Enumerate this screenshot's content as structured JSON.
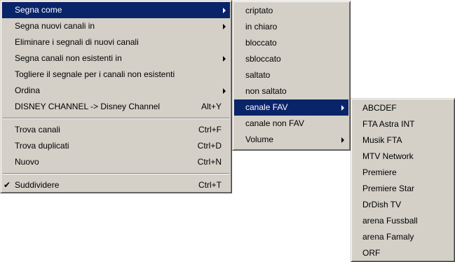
{
  "main_menu": {
    "items": [
      {
        "label": "Segna come",
        "shortcut": "",
        "submenu": true,
        "highlighted": true
      },
      {
        "label": "Segna nuovi canali in",
        "shortcut": "",
        "submenu": true
      },
      {
        "label": "Eliminare i segnali di nuovi canali",
        "shortcut": "",
        "submenu": false
      },
      {
        "label": "Segna canali non esistenti in",
        "shortcut": "",
        "submenu": true
      },
      {
        "label": "Togliere il segnale per i canali non esistenti",
        "shortcut": "",
        "submenu": false
      },
      {
        "label": "Ordina",
        "shortcut": "",
        "submenu": true
      },
      {
        "label": "DISNEY CHANNEL -> Disney Channel",
        "shortcut": "Alt+Y",
        "submenu": false
      }
    ],
    "items2": [
      {
        "label": "Trova canali",
        "shortcut": "Ctrl+F"
      },
      {
        "label": "Trova duplicati",
        "shortcut": "Ctrl+D"
      },
      {
        "label": "Nuovo",
        "shortcut": "Ctrl+N"
      }
    ],
    "items3": [
      {
        "label": "Suddividere",
        "shortcut": "Ctrl+T",
        "checked": true,
        "check_glyph": "✔"
      }
    ]
  },
  "segna_come_menu": {
    "items": [
      {
        "label": "criptato"
      },
      {
        "label": "in chiaro"
      },
      {
        "label": "bloccato"
      },
      {
        "label": "sbloccato"
      },
      {
        "label": "saltato"
      },
      {
        "label": "non saltato"
      },
      {
        "label": "canale FAV",
        "submenu": true,
        "highlighted": true
      },
      {
        "label": "canale non FAV"
      },
      {
        "label": "Volume",
        "submenu": true
      }
    ]
  },
  "fav_menu": {
    "items": [
      {
        "label": "ABCDEF"
      },
      {
        "label": "FTA Astra INT"
      },
      {
        "label": "Musik FTA"
      },
      {
        "label": "MTV Network"
      },
      {
        "label": "Premiere"
      },
      {
        "label": "Premiere Star"
      },
      {
        "label": "DrDish TV"
      },
      {
        "label": "arena Fussball"
      },
      {
        "label": "arena Famaly"
      },
      {
        "label": "ORF"
      }
    ]
  },
  "colors": {
    "menu_bg": "#d4d0c8",
    "highlight_bg": "#0a246a",
    "highlight_text": "#ffffff"
  }
}
